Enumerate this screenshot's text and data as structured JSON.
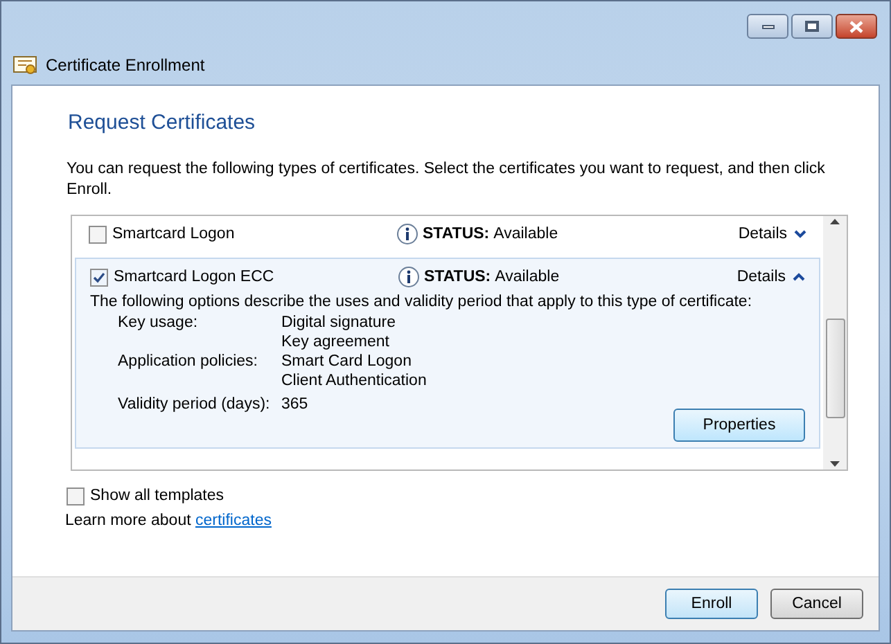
{
  "window": {
    "title": "Certificate Enrollment"
  },
  "heading": "Request Certificates",
  "intro": "You can request the following types of certificates. Select the certificates you want to request, and then click Enroll.",
  "certificates": [
    {
      "name": "Smartcard Logon",
      "checked": false,
      "expanded": false,
      "status_label": "STATUS:",
      "status": "Available",
      "details_label": "Details"
    },
    {
      "name": "Smartcard Logon ECC",
      "checked": true,
      "expanded": true,
      "status_label": "STATUS:",
      "status": "Available",
      "details_label": "Details",
      "description": "The following options describe the uses and validity period that apply to this type of certificate:",
      "properties": [
        {
          "label": "Key usage:",
          "values": [
            "Digital signature",
            "Key agreement"
          ]
        },
        {
          "label": "Application policies:",
          "values": [
            "Smart Card Logon",
            "Client Authentication"
          ]
        },
        {
          "label": "Validity period (days):",
          "values": [
            "365"
          ]
        }
      ],
      "properties_button": "Properties"
    }
  ],
  "show_all_templates": {
    "label": "Show all templates",
    "checked": false
  },
  "learn_more": {
    "text": "Learn more about",
    "link": "certificates"
  },
  "buttons": [
    {
      "label": "Enroll",
      "default": true
    },
    {
      "label": "Cancel",
      "default": false
    }
  ]
}
